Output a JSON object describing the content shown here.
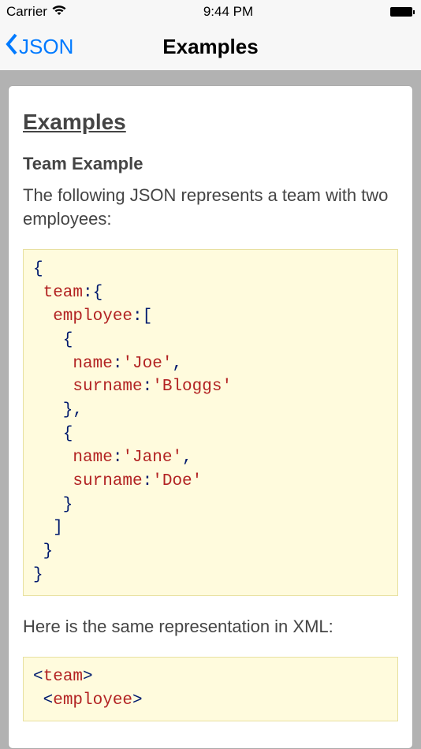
{
  "statusbar": {
    "carrier": "Carrier",
    "time": "9:44 PM"
  },
  "navbar": {
    "back_label": "JSON",
    "title": "Examples"
  },
  "content": {
    "heading": "Examples",
    "subheading": "Team Example",
    "intro": "The following JSON represents a team with two employees:",
    "code1": {
      "l1_a": "{",
      "l2_a": " team",
      "l2_b": ":",
      "l2_c": "{",
      "l3_a": "  employee",
      "l3_b": ":",
      "l3_c": "[",
      "l4_a": "   {",
      "l5_a": "    name",
      "l5_b": ":",
      "l5_c": "'Joe'",
      "l5_d": ",",
      "l6_a": "    surname",
      "l6_b": ":",
      "l6_c": "'Bloggs'",
      "l7_a": "   }",
      "l7_b": ",",
      "l8_a": "   {",
      "l9_a": "    name",
      "l9_b": ":",
      "l9_c": "'Jane'",
      "l9_d": ",",
      "l10_a": "    surname",
      "l10_b": ":",
      "l10_c": "'Doe'",
      "l11_a": "   }",
      "l12_a": "  ]",
      "l13_a": " }",
      "l14_a": "}"
    },
    "intro2": "Here is the same representation in XML:",
    "code2": {
      "l1_a": "<",
      "l1_b": "team",
      "l1_c": ">",
      "l2_a": " <",
      "l2_b": "employee",
      "l2_c": ">"
    }
  }
}
